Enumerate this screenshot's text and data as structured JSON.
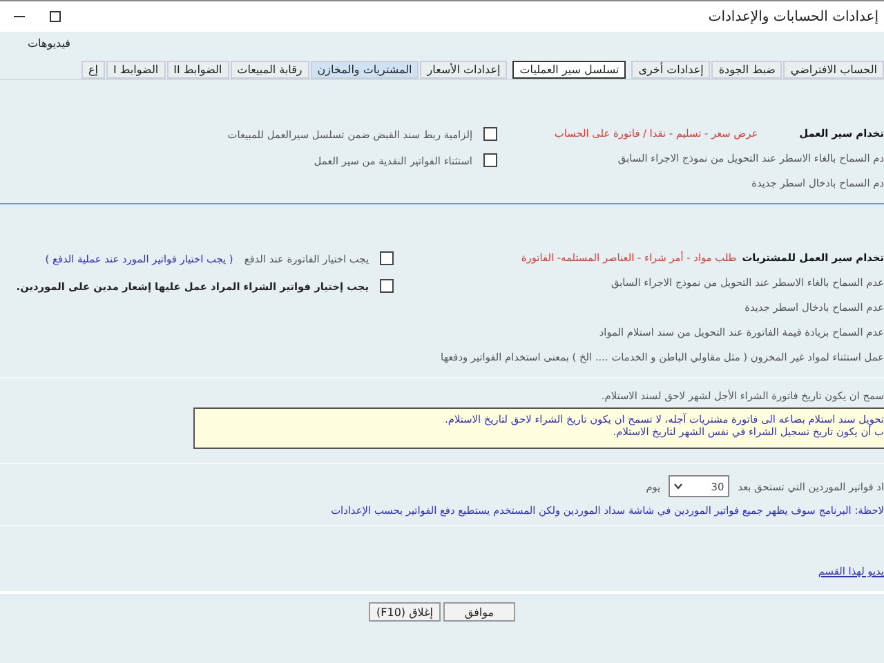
{
  "window": {
    "title": "إعدادات الحسابات والإعدادات"
  },
  "menu": [
    "فيديوهات"
  ],
  "tabs": [
    {
      "label": "الحساب الافتراضي",
      "selected": false,
      "highlighted": false
    },
    {
      "label": "ضبط الجودة",
      "selected": false,
      "highlighted": false
    },
    {
      "label": "إعدادات أخرى",
      "selected": false,
      "highlighted": false
    },
    {
      "label": "تسلسل سير العمليات",
      "selected": true,
      "highlighted": false
    },
    {
      "label": "إعدادات الأسعار",
      "selected": false,
      "highlighted": false
    },
    {
      "label": "المشتريات والمخازن",
      "selected": false,
      "highlighted": true
    },
    {
      "label": "رقابة المبيعات",
      "selected": false,
      "highlighted": false
    },
    {
      "label": "الضوابط II",
      "selected": false,
      "highlighted": false
    },
    {
      "label": "الضوابط I",
      "selected": false,
      "highlighted": false
    },
    {
      "label": "إع",
      "selected": false,
      "highlighted": false
    }
  ],
  "sales_workflow": {
    "title": "تخدام سير العمل",
    "stages": "عرض سعر - تسليم - نقدا / فاتورة على الحساب",
    "options": [
      "دم السماح بالغاء الاسطر عند التحويل من نموذج الاجراء السابق",
      "دم السماح بادخال اسطر جديدة"
    ],
    "checkboxes": [
      {
        "label": "إلزامية ربط سند القبض ضمن تسلسل سيرالعمل للمبيعات",
        "checked": false,
        "bold": false
      },
      {
        "label": "استثناء الفواتير النقدية من سير العمل",
        "checked": false,
        "bold": false
      }
    ]
  },
  "purchase_workflow": {
    "title": "تخدام سير العمل للمشتريات",
    "stages": "طلب مواد - أمر شراء - العناصر المستلمه- الفاتورة",
    "options": [
      "عدم السماح بالغاء الاسطر عند التحويل من نموذج الاجراء السابق",
      "عدم السماح بادخال اسطر جديدة",
      "عدم السماح بزيادة قيمة الفاتورة عند التحويل من سند استلام المواد",
      "عمل استثناء لمواد غير المخزون ( مثل مقاولي الباطن و الخدمات .... الخ ) بمعنى استخدام الفواتير ودفعها"
    ],
    "checkboxes": [
      {
        "label": "يجب اختيار الفاتورة عند الدفع",
        "checked": false,
        "bold": false,
        "note": "( يجب اختيار فواتير المورد عند عملية الدفع )"
      },
      {
        "label": "يجب إختيار فواتير الشراء المراد عمل عليها إشعار مدين على الموردين.",
        "checked": false,
        "bold": true
      }
    ]
  },
  "date_rule": {
    "label": "سمح ان يكون تاريخ فاتورة الشراء الأجل لشهر لاحق لسند الاستلام.",
    "info_lines": [
      "تحويل سند استلام بضاعه الى فاتورة مشتريات آجله، لا تسمح ان يكون تاريخ الشراء لاحق لتاريخ الاستلام.",
      "ب أن يكون تاريخ تسجيل الشراء في نفس الشهر لتاريخ الاستلام."
    ]
  },
  "due_days": {
    "label": "اد فواتير الموردين التي تستحق بعد",
    "value": "30",
    "unit": "يوم"
  },
  "note": "لاحظة: البرنامج سوف يظهر جميع فواتير الموردين في شاشة سداد الموردين ولكن المستخدم يستطيع دفع الفواتير بحسب الإعدادات",
  "video_link": "يديو لهذا القسم",
  "buttons": [
    "موافق",
    "إغلاق (F10)"
  ]
}
